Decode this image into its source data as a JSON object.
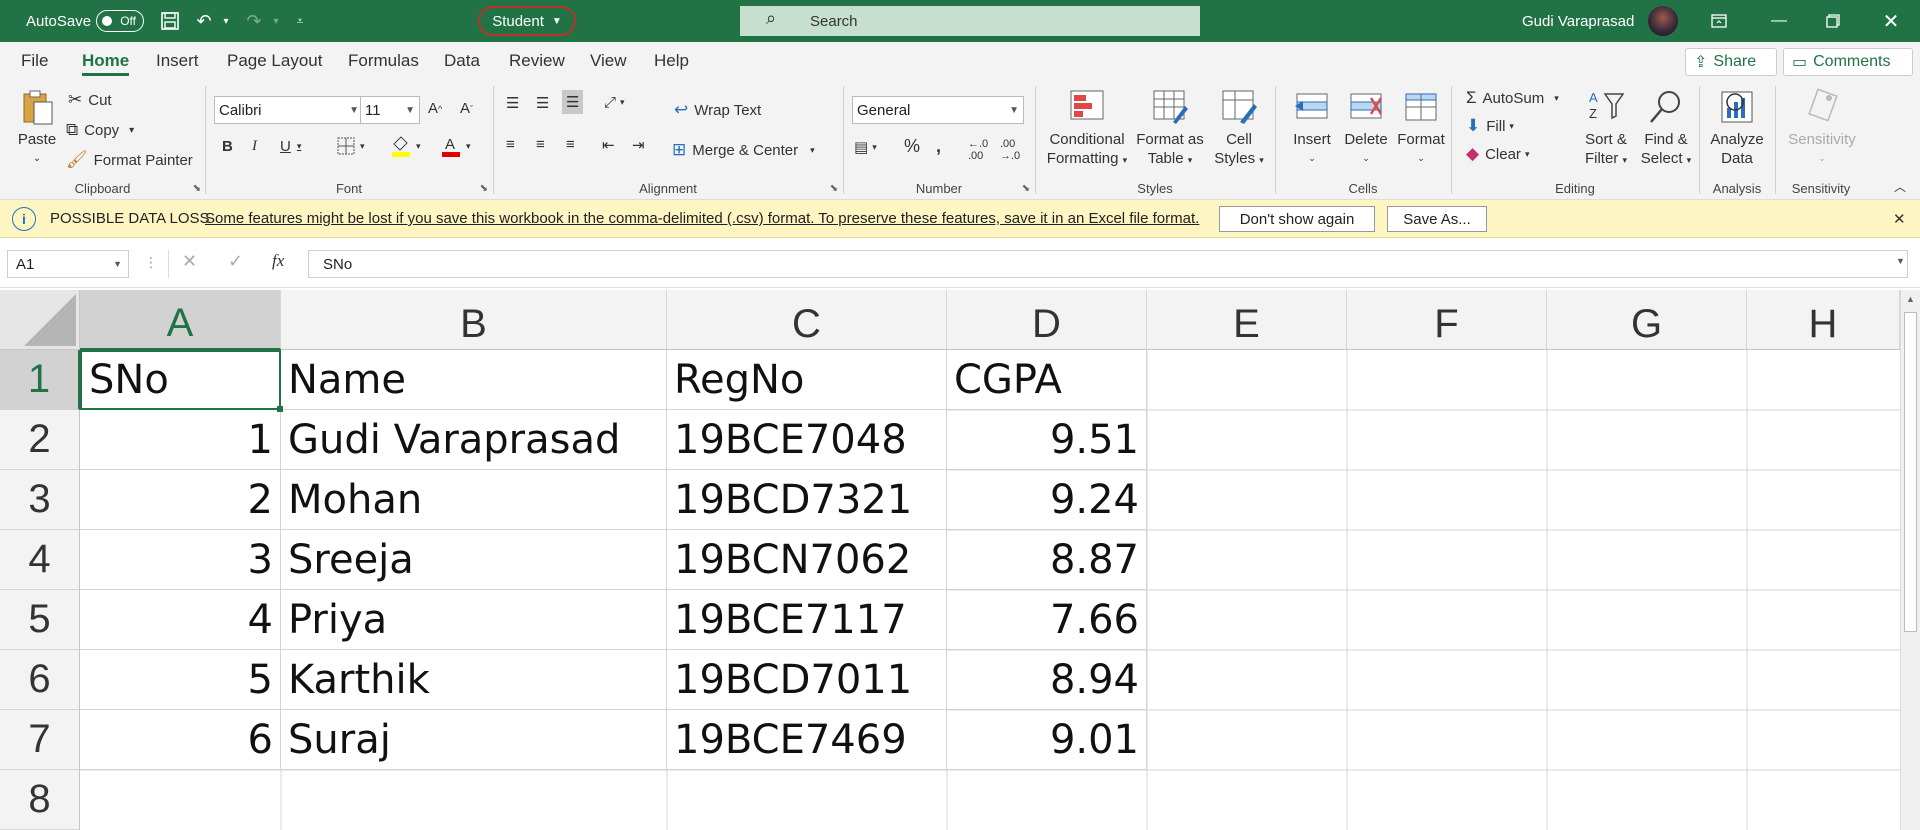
{
  "titlebar": {
    "autosave_label": "AutoSave",
    "autosave_state": "Off",
    "document_title": "Student",
    "search_placeholder": "Search",
    "user_name": "Gudi Varaprasad"
  },
  "menu": {
    "tabs": [
      "File",
      "Home",
      "Insert",
      "Page Layout",
      "Formulas",
      "Data",
      "Review",
      "View",
      "Help"
    ],
    "active_tab": "Home",
    "share_label": "Share",
    "comments_label": "Comments"
  },
  "ribbon": {
    "clipboard": {
      "paste": "Paste",
      "cut": "Cut",
      "copy": "Copy",
      "format_painter": "Format Painter",
      "label": "Clipboard"
    },
    "font": {
      "font_name": "Calibri",
      "font_size": "11",
      "label": "Font"
    },
    "alignment": {
      "wrap_text": "Wrap Text",
      "merge_center": "Merge & Center",
      "label": "Alignment"
    },
    "number": {
      "format": "General",
      "label": "Number"
    },
    "styles": {
      "conditional_1": "Conditional",
      "conditional_2": "Formatting",
      "format_table_1": "Format as",
      "format_table_2": "Table",
      "cell_styles_1": "Cell",
      "cell_styles_2": "Styles",
      "label": "Styles"
    },
    "cells": {
      "insert": "Insert",
      "delete": "Delete",
      "format": "Format",
      "label": "Cells"
    },
    "editing": {
      "autosum": "AutoSum",
      "fill": "Fill",
      "clear": "Clear",
      "sort_1": "Sort &",
      "sort_2": "Filter",
      "find_1": "Find &",
      "find_2": "Select",
      "label": "Editing"
    },
    "analysis": {
      "analyze_1": "Analyze",
      "analyze_2": "Data",
      "label": "Analysis"
    },
    "sensitivity": {
      "button": "Sensitivity",
      "label": "Sensitivity"
    }
  },
  "message_bar": {
    "title": "POSSIBLE DATA LOSS",
    "text": "Some features might be lost if you save this workbook in the comma-delimited (.csv) format. To preserve these features, save it in an Excel file format.",
    "dont_show": "Don't show again",
    "save_as": "Save As..."
  },
  "formula_bar": {
    "name_box": "A1",
    "fx": "fx",
    "content": "SNo"
  },
  "sheet": {
    "columns": [
      "A",
      "B",
      "C",
      "D",
      "E",
      "F",
      "G",
      "H"
    ],
    "rows": [
      "1",
      "2",
      "3",
      "4",
      "5",
      "6",
      "7",
      "8"
    ],
    "header_row": [
      "SNo",
      "Name",
      "RegNo",
      "CGPA"
    ],
    "data": [
      [
        "1",
        "Gudi Varaprasad",
        "19BCE7048",
        "9.51"
      ],
      [
        "2",
        "Mohan",
        "19BCD7321",
        "9.24"
      ],
      [
        "3",
        "Sreeja",
        "19BCN7062",
        "8.87"
      ],
      [
        "4",
        "Priya",
        "19BCE7117",
        "7.66"
      ],
      [
        "5",
        "Karthik",
        "19BCD7011",
        "8.94"
      ],
      [
        "6",
        "Suraj",
        "19BCE7469",
        "9.01"
      ]
    ]
  },
  "colors": {
    "accent": "#217346",
    "message_bg": "#fdf6c3",
    "title_highlight": "#c0312b"
  }
}
